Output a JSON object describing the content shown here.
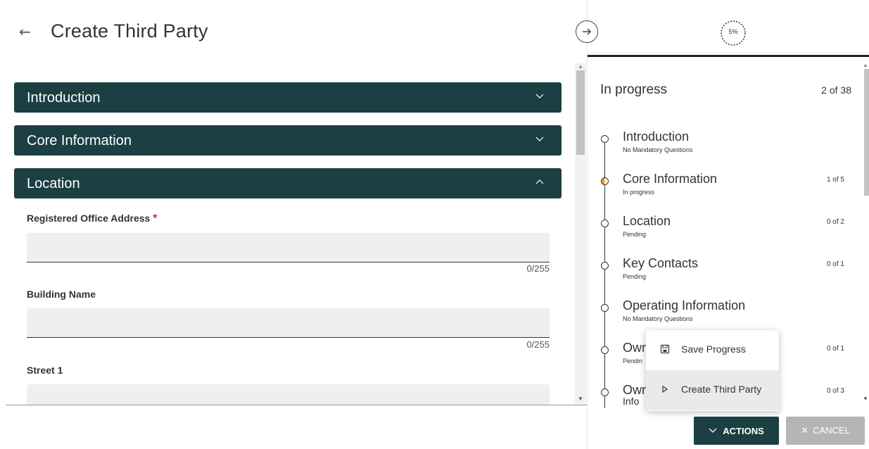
{
  "header": {
    "back_icon": "arrow-left-icon",
    "title": "Create Third Party"
  },
  "sections": [
    {
      "label": "Introduction",
      "state": "collapsed"
    },
    {
      "label": "Core Information",
      "state": "collapsed"
    },
    {
      "label": "Location",
      "state": "expanded"
    }
  ],
  "form": {
    "fields": [
      {
        "label": "Registered Office Address",
        "required": true,
        "value": "",
        "counter": "0/255"
      },
      {
        "label": "Building Name",
        "required": false,
        "value": "",
        "counter": "0/255"
      },
      {
        "label": "Street 1",
        "required": false,
        "value": ""
      }
    ],
    "required_marker": "*"
  },
  "progress": {
    "percent_label": "5%",
    "percent": 5,
    "title": "In progress",
    "count": "2 of 38",
    "steps": [
      {
        "name": "Introduction",
        "status": "No Mandatory Questions",
        "count": ""
      },
      {
        "name": "Core Information",
        "status": "In progress",
        "count": "1 of 5"
      },
      {
        "name": "Location",
        "status": "Pending",
        "count": "0 of 2"
      },
      {
        "name": "Key Contacts",
        "status": "Pending",
        "count": "0 of 1"
      },
      {
        "name": "Operating Information",
        "status": "No Mandatory Questions",
        "count": ""
      },
      {
        "name": "Owr",
        "status": "Pendin",
        "count": "0 of 1"
      },
      {
        "name": "Owr",
        "status": "Info",
        "count": "0 of 3"
      }
    ]
  },
  "menu": {
    "items": [
      {
        "label": "Save Progress",
        "icon": "save-icon"
      },
      {
        "label": "Create Third Party",
        "icon": "play-icon"
      }
    ]
  },
  "footer": {
    "actions_label": "ACTIONS",
    "cancel_label": "CANCEL"
  },
  "colors": {
    "primary": "#1b3f42",
    "required": "#d9262c",
    "in_progress": "#f0a030",
    "disabled": "#b5b5b5"
  }
}
